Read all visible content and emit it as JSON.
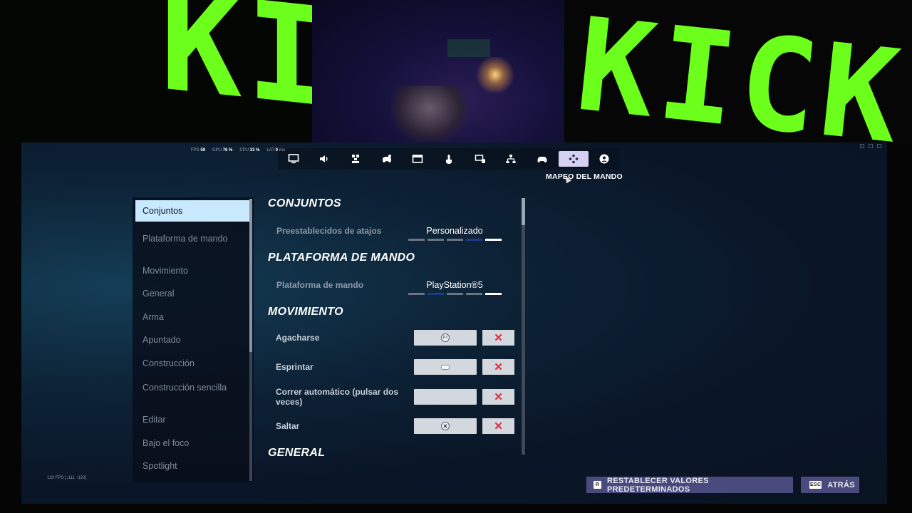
{
  "background": {
    "kick_left_text": "KI",
    "kick_right_text": "KICK"
  },
  "perf": {
    "fps_label": "FPS",
    "fps_value": "59",
    "gpu_label": "GPU",
    "gpu_value": "76 %",
    "cpu_label": "CPU",
    "cpu_value": "33 %",
    "lat_label": "LAT",
    "lat_value": "0 ms"
  },
  "topnav": {
    "items": [
      {
        "icon": "monitor-icon"
      },
      {
        "icon": "speaker-icon"
      },
      {
        "icon": "accessibility-icon"
      },
      {
        "icon": "controller-settings-icon"
      },
      {
        "icon": "window-icon"
      },
      {
        "icon": "touch-icon"
      },
      {
        "icon": "keyboard-mouse-icon"
      },
      {
        "icon": "network-icon"
      },
      {
        "icon": "gamepad-icon"
      },
      {
        "icon": "controller-mapping-icon",
        "active": true
      },
      {
        "icon": "account-icon"
      }
    ],
    "tooltip": "MAPEO DEL MANDO"
  },
  "sidebar": {
    "items": [
      {
        "label": "Conjuntos",
        "active": true
      },
      {
        "label": "Plataforma de mando"
      },
      {
        "label": "Movimiento"
      },
      {
        "label": "General"
      },
      {
        "label": "Arma"
      },
      {
        "label": "Apuntado"
      },
      {
        "label": "Construcción"
      },
      {
        "label": "Construcción sencilla"
      },
      {
        "label": "Editar"
      },
      {
        "label": "Bajo el foco"
      },
      {
        "label": "Spotlight"
      }
    ]
  },
  "sections": {
    "conjuntos": {
      "title": "CONJUNTOS",
      "preset_label": "Preestablecidos de atajos",
      "preset_value": "Personalizado"
    },
    "plataforma": {
      "title": "PLATAFORMA DE MANDO",
      "platform_label": "Plataforma de mando",
      "platform_value": "PlayStation®5"
    },
    "movimiento": {
      "title": "MOVIMIENTO",
      "binds": [
        {
          "label": "Agacharse",
          "glyph": "R3"
        },
        {
          "label": "Esprintar",
          "glyph": ""
        },
        {
          "label": "Correr automático (pulsar dos veces)",
          "glyph": ""
        },
        {
          "label": "Saltar",
          "glyph": "✕"
        }
      ],
      "clear_glyph": "✕"
    },
    "general": {
      "title": "GENERAL"
    }
  },
  "footer": {
    "fps_small": "120 FPS [↓111 ↑120]",
    "reset_key": "R",
    "reset_label": "RESTABLECER VALORES PREDETERMINADOS",
    "back_key": "ESC",
    "back_label": "ATRÁS"
  }
}
